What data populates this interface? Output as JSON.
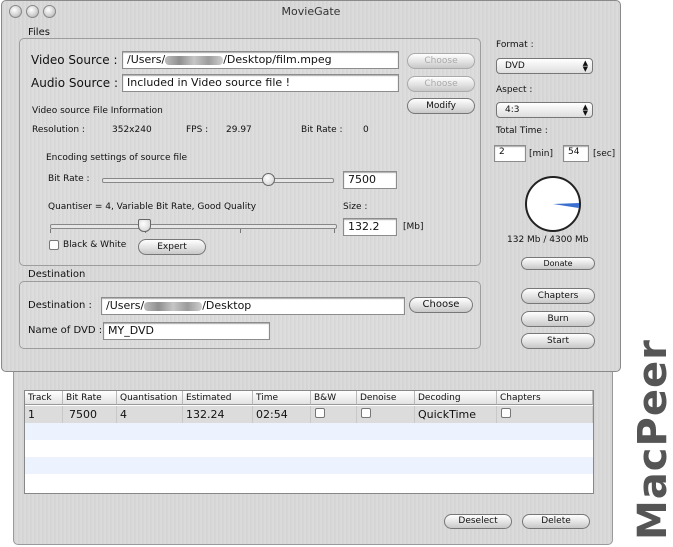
{
  "window": {
    "title": "MovieGate"
  },
  "files": {
    "group_title": "Files",
    "video_source_label": "Video Source :",
    "video_source_prefix": "/Users/",
    "video_source_suffix": "/Desktop/film.mpeg",
    "audio_source_label": "Audio Source :",
    "audio_source_value": "Included in Video source file !",
    "choose_label": "Choose",
    "modify_label": "Modify",
    "info_title": "Video source File Information",
    "resolution_label": "Resolution :",
    "resolution_value": "352x240",
    "fps_label": "FPS :",
    "fps_value": "29.97",
    "bitrate_label": "Bit Rate :",
    "bitrate_value": "0",
    "encoding_title": "Encoding settings of source file",
    "enc_bitrate_label": "Bit Rate :",
    "enc_bitrate_value": "7500",
    "enc_bitrate_slider": 0.72,
    "quantiser_text": "Quantiser = 4, Variable Bit Rate, Good Quality",
    "quantiser_slider": 0.33,
    "size_label": "Size :",
    "size_value": "132.2",
    "size_unit": "[Mb]",
    "bw_label": "Black & White",
    "expert_label": "Expert"
  },
  "destination": {
    "group_title": "Destination",
    "label": "Destination :",
    "path_prefix": "/Users/",
    "path_suffix": "/Desktop",
    "choose_label": "Choose",
    "dvd_name_label": "Name of DVD :",
    "dvd_name_value": "MY_DVD"
  },
  "side": {
    "format_label": "Format :",
    "format_value": "DVD",
    "aspect_label": "Aspect :",
    "aspect_value": "4:3",
    "total_time_label": "Total Time :",
    "minutes": "2",
    "min_unit": "[min]",
    "seconds": "54",
    "sec_unit": "[sec]",
    "usage_text": "132 Mb / 4300 Mb",
    "usage_fraction": 0.031,
    "donate_label": "Donate",
    "chapters_label": "Chapters",
    "burn_label": "Burn",
    "start_label": "Start"
  },
  "table": {
    "columns": [
      "Track",
      "Bit Rate",
      "Quantisation",
      "Estimated",
      "Time",
      "B&W",
      "Denoise",
      "Decoding",
      "Chapters"
    ],
    "rows": [
      {
        "track": "1",
        "bitrate": "7500",
        "quant": "4",
        "estimated": "132.24",
        "time": "02:54",
        "decoding": "QuickTime"
      }
    ],
    "deselect_label": "Deselect",
    "delete_label": "Delete"
  },
  "watermark": "MacPeer",
  "colors": {
    "row_stripe": "#edf3fe",
    "selected_row": "#dcdcdc",
    "pie_fill": "#3a6fd0"
  }
}
